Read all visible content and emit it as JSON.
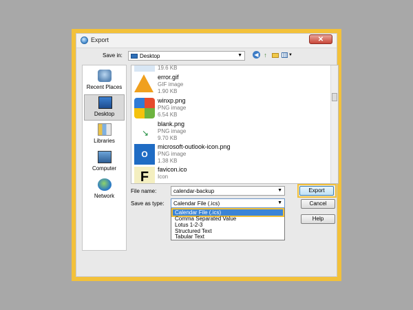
{
  "window": {
    "title": "Export",
    "close_glyph": "✕"
  },
  "save_in": {
    "label": "Save in:",
    "value": "Desktop"
  },
  "toolbar": {
    "back_glyph": "◀",
    "up_glyph": "↑"
  },
  "places": [
    {
      "label": "Recent Places",
      "icon": "recent-places-icon"
    },
    {
      "label": "Desktop",
      "icon": "desktop-icon",
      "active": true
    },
    {
      "label": "Libraries",
      "icon": "libraries-icon"
    },
    {
      "label": "Computer",
      "icon": "computer-icon"
    },
    {
      "label": "Network",
      "icon": "network-icon"
    }
  ],
  "files": [
    {
      "name": "",
      "type": "",
      "size": "19.6 KB",
      "icon": "partial-file-icon"
    },
    {
      "name": "error.gif",
      "type": "GIF image",
      "size": "1.90 KB",
      "icon": "warning-icon"
    },
    {
      "name": "winxp.png",
      "type": "PNG image",
      "size": "6.54 KB",
      "icon": "windows-logo-icon"
    },
    {
      "name": "blank.png",
      "type": "PNG image",
      "size": "9.70 KB",
      "icon": "blank-image-icon"
    },
    {
      "name": "microsoft-outlook-icon.png",
      "type": "PNG image",
      "size": "1.38 KB",
      "icon": "outlook-icon"
    },
    {
      "name": "favicon.ico",
      "type": "Icon",
      "size": "",
      "icon": "favicon-icon"
    }
  ],
  "file_name": {
    "label": "File name:",
    "value": "calendar-backup"
  },
  "save_as_type": {
    "label": "Save as type:",
    "value": "Calendar File (.ics)",
    "options": [
      "Calendar File (.ics)",
      "Comma Separated Value",
      "Lotus 1-2-3",
      "Structured Text",
      "Tabular Text"
    ],
    "selected_index": 0
  },
  "buttons": {
    "export": "Export",
    "cancel": "Cancel",
    "help": "Help"
  },
  "colors": {
    "highlight": "#f3c13a",
    "selection": "#3b84d6",
    "backdrop": "#a8a8a8"
  }
}
